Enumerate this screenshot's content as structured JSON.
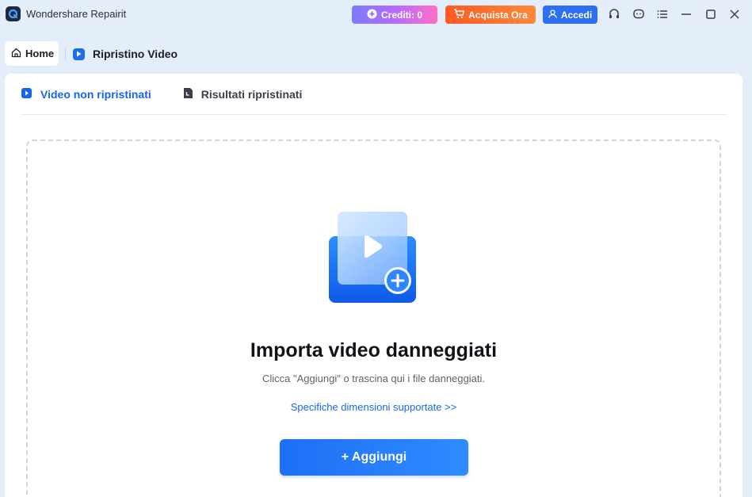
{
  "app": {
    "title": "Wondershare Repairit"
  },
  "toolbar": {
    "credits_label": "Crediti: 0",
    "buy_label": "Acquista Ora",
    "login_label": "Accedi"
  },
  "nav": {
    "home_label": "Home",
    "module_label": "Ripristino Video"
  },
  "subtabs": [
    {
      "label": "Video non ripristinati",
      "active": true
    },
    {
      "label": "Risultati ripristinati",
      "active": false
    }
  ],
  "dropzone": {
    "title": "Importa video danneggiati",
    "subtitle": "Clicca \"Aggiungi\" o trascina qui i file danneggiati.",
    "link": "Specifiche dimensioni supportate >>",
    "add_button": "+ Aggiungi"
  },
  "colors": {
    "accent": "#1765ea",
    "background": "#e4eefb",
    "buy": "#ff6a2a",
    "login": "#2d6ef5"
  },
  "icons": {
    "app": "repairit-logo-icon",
    "credits": "plus-circle-icon",
    "buy": "cart-icon",
    "login": "user-icon",
    "support": "headset-icon",
    "chat": "chat-icon",
    "menu": "menu-icon",
    "minimize": "minimize-icon",
    "maximize": "maximize-icon",
    "close": "close-icon",
    "home": "home-icon",
    "module": "video-repair-icon",
    "tab_pending": "video-file-icon",
    "tab_results": "document-icon",
    "hero": "video-add-illustration-icon"
  }
}
